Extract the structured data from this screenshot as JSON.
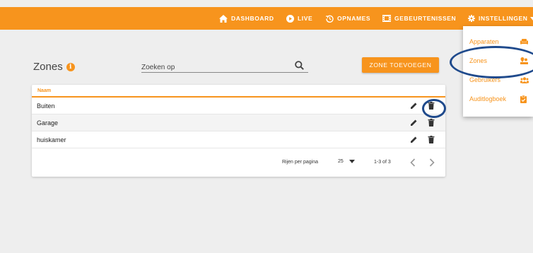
{
  "nav": {
    "dashboard": "DASHBOARD",
    "live": "LIVE",
    "recordings": "OPNAMES",
    "events": "GEBEURTENISSEN",
    "settings": "INSTELLINGEN"
  },
  "page": {
    "title": "Zones",
    "search_placeholder": "Zoeken op",
    "add_button": "ZONE TOEVOEGEN"
  },
  "table": {
    "column_name": "Naam",
    "rows": [
      {
        "name": "Buiten"
      },
      {
        "name": "Garage"
      },
      {
        "name": "huiskamer"
      }
    ],
    "rows_per_page_label": "Rijen per pagina",
    "rows_per_page_value": "25",
    "range": "1-3 of 3"
  },
  "settings_menu": {
    "items": [
      "Apparaten",
      "Zones",
      "Gebruikers",
      "Auditlogboek"
    ]
  },
  "colors": {
    "accent": "#f7941d",
    "highlight_ring": "#1f4a8c"
  }
}
